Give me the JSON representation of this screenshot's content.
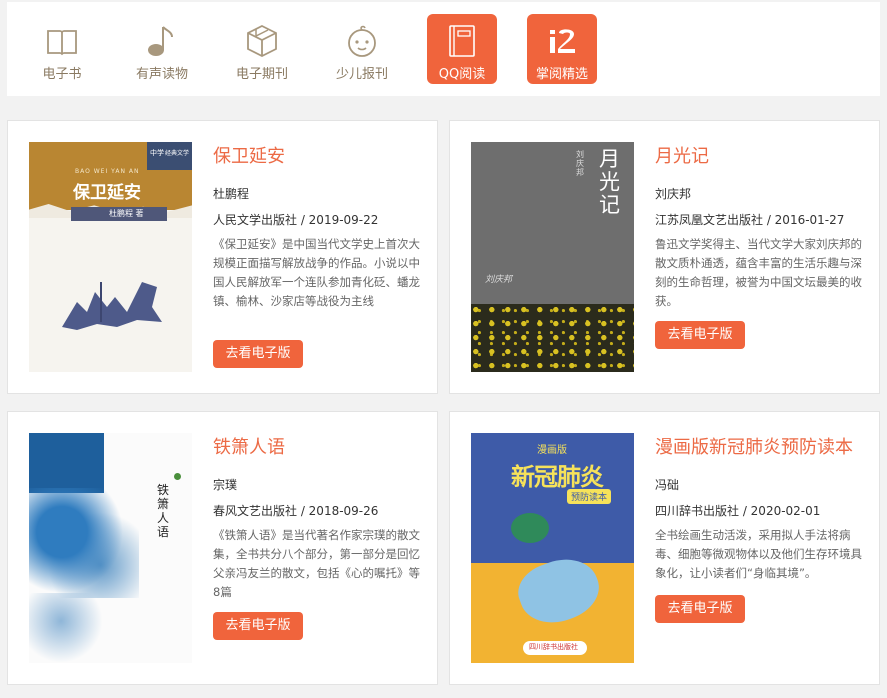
{
  "tabs": [
    {
      "label": "电子书",
      "icon": "open-book-icon"
    },
    {
      "label": "有声读物",
      "icon": "music-note-icon"
    },
    {
      "label": "电子期刊",
      "icon": "box-icon"
    },
    {
      "label": "少儿报刊",
      "icon": "baby-face-icon"
    },
    {
      "label": "QQ阅读",
      "icon": "book-icon"
    },
    {
      "label": "掌阅精选",
      "icon": "ireader-logo-icon"
    }
  ],
  "colors": {
    "accent": "#f0643c",
    "title": "#ec6a45"
  },
  "books": [
    {
      "title": "保卫延安",
      "author": "杜鹏程",
      "publisher": "人民文学出版社 / 2019-09-22",
      "desc": "《保卫延安》是中国当代文学史上首次大规模正面描写解放战争的作品。小说以中国人民解放军一个连队参加青化砭、蟠龙镇、榆林、沙家店等战役为主线",
      "button": "去看电子版",
      "cover": {
        "title": "保卫延安",
        "pinyin": "BAO WEI YAN AN",
        "author": "杜鹏程 著",
        "series": "经典文学",
        "series2": "中学"
      }
    },
    {
      "title": "月光记",
      "author": "刘庆邦",
      "publisher": "江苏凤凰文艺出版社 / 2016-01-27",
      "desc": "鲁迅文学奖得主、当代文学大家刘庆邦的散文质朴通透，蕴含丰富的生活乐趣与深刻的生命哲理，被誉为中国文坛最美的收获。",
      "button": "去看电子版",
      "cover": {
        "title": "月光记",
        "author": "刘庆邦",
        "signature": "刘庆邦"
      }
    },
    {
      "title": "铁箫人语",
      "author": "宗璞",
      "publisher": "春风文艺出版社 / 2018-09-26",
      "desc": "《铁箫人语》是当代著名作家宗璞的散文集，全书共分八个部分，第一部分是回忆父亲冯友兰的散文，包括《心的嘱托》等8篇",
      "button": "去看电子版",
      "cover": {
        "title": "铁箫人语"
      }
    },
    {
      "title": "漫画版新冠肺炎预防读本",
      "author": "冯础",
      "publisher": "四川辞书出版社 / 2020-02-01",
      "desc": "全书绘画生动活泼，采用拟人手法将病毒、细胞等微观物体以及他们生存环境具象化，让小读者们“身临其境”。",
      "button": "去看电子版",
      "cover": {
        "line1": "漫画版",
        "line2": "新冠肺炎",
        "line3": "预防读本",
        "publisher": "四川辞书出版社"
      }
    }
  ]
}
